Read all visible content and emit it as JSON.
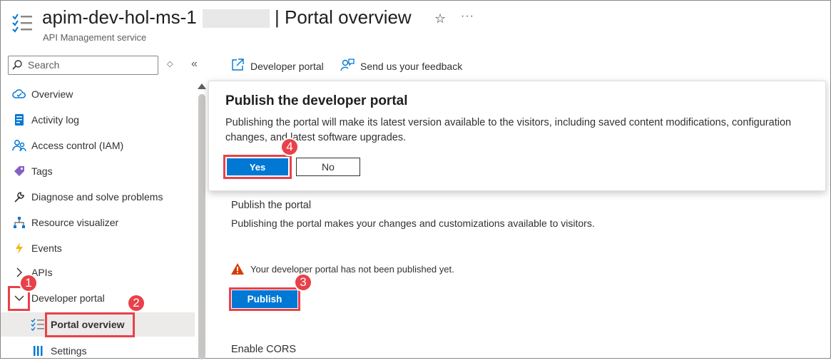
{
  "header": {
    "title": "apim-dev-hol-ms-1",
    "separator_title": "| Portal overview",
    "subtitle": "API Management service"
  },
  "search": {
    "placeholder": "Search"
  },
  "sidebar": {
    "items": [
      {
        "label": "Overview",
        "icon": "cloud-icon"
      },
      {
        "label": "Activity log",
        "icon": "activity-log-icon"
      },
      {
        "label": "Access control (IAM)",
        "icon": "people-icon"
      },
      {
        "label": "Tags",
        "icon": "tag-icon"
      },
      {
        "label": "Diagnose and solve problems",
        "icon": "wrench-icon"
      },
      {
        "label": "Resource visualizer",
        "icon": "hierarchy-icon"
      },
      {
        "label": "Events",
        "icon": "lightning-icon"
      },
      {
        "label": "APIs",
        "icon": "chevron-right-icon"
      },
      {
        "label": "Developer portal",
        "icon": "chevron-down-icon"
      },
      {
        "label": "Portal overview",
        "icon": "list-check-icon"
      },
      {
        "label": "Settings",
        "icon": "settings-bars-icon"
      }
    ]
  },
  "toolbar": {
    "developer_portal": "Developer portal",
    "feedback": "Send us your feedback"
  },
  "dialog": {
    "title": "Publish the developer portal",
    "body": "Publishing the portal will make its latest version available to the visitors, including saved content modifications, configuration changes, and latest software upgrades.",
    "yes": "Yes",
    "no": "No"
  },
  "main": {
    "publish_title": "Publish the portal",
    "publish_desc": "Publishing the portal makes your changes and customizations available to visitors.",
    "warning": "Your developer portal has not been published yet.",
    "publish_button": "Publish",
    "cors_title": "Enable CORS"
  },
  "badges": [
    "1",
    "2",
    "3",
    "4"
  ],
  "colors": {
    "accent": "#0078d4",
    "highlight": "#e8414a",
    "warning": "#d83b01"
  }
}
